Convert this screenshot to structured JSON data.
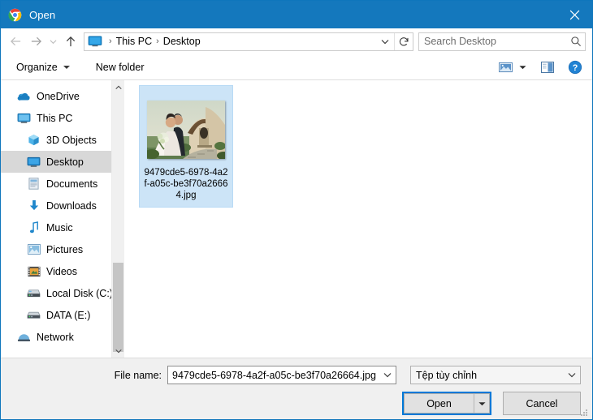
{
  "window": {
    "title": "Open",
    "app_icon": "chrome-icon",
    "close_label": "✕",
    "accent_color": "#1478bd"
  },
  "address_bar": {
    "back_label": "←",
    "forward_label": "→",
    "recent_label": "˅",
    "up_label": "↑",
    "root_icon": "desktop-monitor-icon",
    "breadcrumbs": [
      {
        "label": "This PC"
      },
      {
        "label": "Desktop"
      }
    ],
    "separator": "›",
    "dropdown_label": "˅",
    "refresh_label": "↻"
  },
  "search": {
    "placeholder": "Search Desktop",
    "value": "",
    "icon": "search-icon"
  },
  "toolbar": {
    "organize_label": "Organize",
    "new_folder_label": "New folder",
    "view_icon": "view-mode-icon",
    "view_caret": "▼",
    "preview_pane_icon": "preview-pane-icon",
    "help_icon": "help-icon",
    "help_label": "?"
  },
  "sidebar": {
    "items": [
      {
        "label": "OneDrive",
        "icon": "onedrive-cloud-icon",
        "indent": false,
        "selected": false
      },
      {
        "label": "This PC",
        "icon": "this-pc-monitor-icon",
        "indent": false,
        "selected": false
      },
      {
        "label": "3D Objects",
        "icon": "3d-objects-icon",
        "indent": true,
        "selected": false
      },
      {
        "label": "Desktop",
        "icon": "desktop-icon",
        "indent": true,
        "selected": true
      },
      {
        "label": "Documents",
        "icon": "documents-icon",
        "indent": true,
        "selected": false
      },
      {
        "label": "Downloads",
        "icon": "downloads-icon",
        "indent": true,
        "selected": false
      },
      {
        "label": "Music",
        "icon": "music-note-icon",
        "indent": true,
        "selected": false
      },
      {
        "label": "Pictures",
        "icon": "pictures-icon",
        "indent": true,
        "selected": false
      },
      {
        "label": "Videos",
        "icon": "videos-icon",
        "indent": true,
        "selected": false
      },
      {
        "label": "Local Disk (C:)",
        "icon": "hard-drive-icon",
        "indent": true,
        "selected": false
      },
      {
        "label": "DATA (E:)",
        "icon": "hard-drive-icon",
        "indent": true,
        "selected": false
      },
      {
        "label": "Network",
        "icon": "network-icon",
        "indent": false,
        "selected": false
      }
    ],
    "scroll_up_label": "˄",
    "scroll_down_label": "˅"
  },
  "file_list": {
    "items": [
      {
        "name": "9479cde5-6978-4a2f-a05c-be3f70a26664.jpg",
        "thumbnail": "wedding-photo-thumbnail",
        "selected": true
      }
    ],
    "selection_color": "#cce4f7"
  },
  "footer": {
    "file_name_label": "File name:",
    "file_name_value": "9479cde5-6978-4a2f-a05c-be3f70a26664.jpg",
    "file_name_arrow": "˅",
    "filter_value": "Tệp tùy chỉnh",
    "filter_arrow": "˅",
    "open_label": "Open",
    "open_split_arrow": "▼",
    "cancel_label": "Cancel",
    "focus_color": "#0078d7"
  }
}
